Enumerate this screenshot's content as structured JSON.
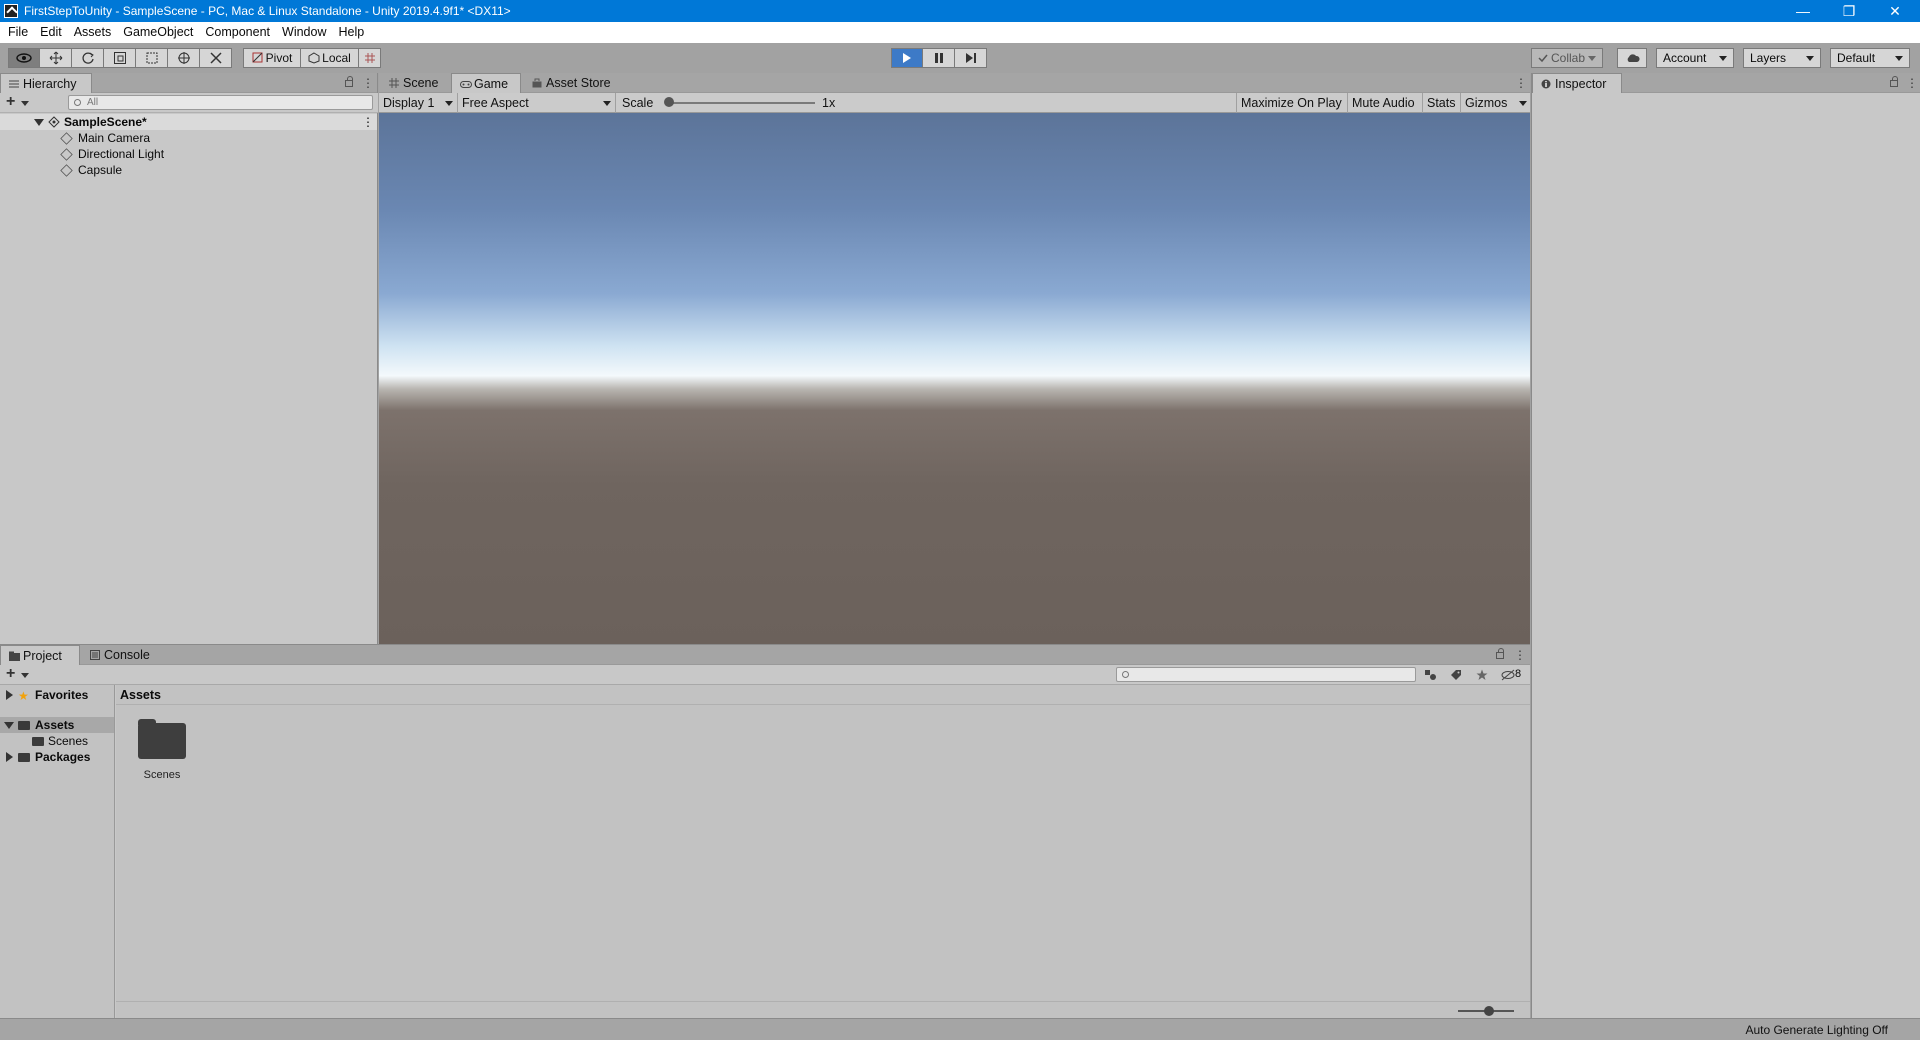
{
  "window": {
    "title": "FirstStepToUnity - SampleScene - PC, Mac & Linux Standalone - Unity 2019.4.9f1* <DX11>",
    "controls": [
      "minimize",
      "restore",
      "close"
    ]
  },
  "menubar": {
    "items": [
      "File",
      "Edit",
      "Assets",
      "GameObject",
      "Component",
      "Window",
      "Help"
    ]
  },
  "toolbar": {
    "tools": [
      "view-tool-icon",
      "move-tool-icon",
      "rotate-tool-icon",
      "scale-tool-icon",
      "rect-tool-icon",
      "transform-tool-icon",
      "custom-tool-icon"
    ],
    "pivot_label": "Pivot",
    "local_label": "Local",
    "play_state": "playing",
    "collab_label": "Collab",
    "account_label": "Account",
    "layers_label": "Layers",
    "layout_label": "Default",
    "colors": {
      "play_active": "#3d7ac7"
    }
  },
  "hierarchy": {
    "tab_label": "Hierarchy",
    "search_placeholder": "All",
    "scene_name": "SampleScene*",
    "items": [
      {
        "label": "Main Camera"
      },
      {
        "label": "Directional Light"
      },
      {
        "label": "Capsule"
      }
    ]
  },
  "center_tabs": {
    "scene_label": "Scene",
    "game_label": "Game",
    "asset_store_label": "Asset Store"
  },
  "game_view": {
    "display": "Display 1",
    "aspect": "Free Aspect",
    "scale_label": "Scale",
    "scale_value": "1x",
    "maximize_label": "Maximize On Play",
    "mute_label": "Mute Audio",
    "stats_label": "Stats",
    "gizmos_label": "Gizmos"
  },
  "inspector": {
    "tab_label": "Inspector"
  },
  "project": {
    "project_tab": "Project",
    "console_tab": "Console",
    "hidden_count": "8",
    "sidebar": {
      "favorites": "Favorites",
      "assets": "Assets",
      "scenes": "Scenes",
      "packages": "Packages"
    },
    "breadcrumb": "Assets",
    "items": [
      {
        "label": "Scenes",
        "icon": "folder-icon"
      }
    ]
  },
  "status": {
    "text": "Auto Generate Lighting Off"
  }
}
